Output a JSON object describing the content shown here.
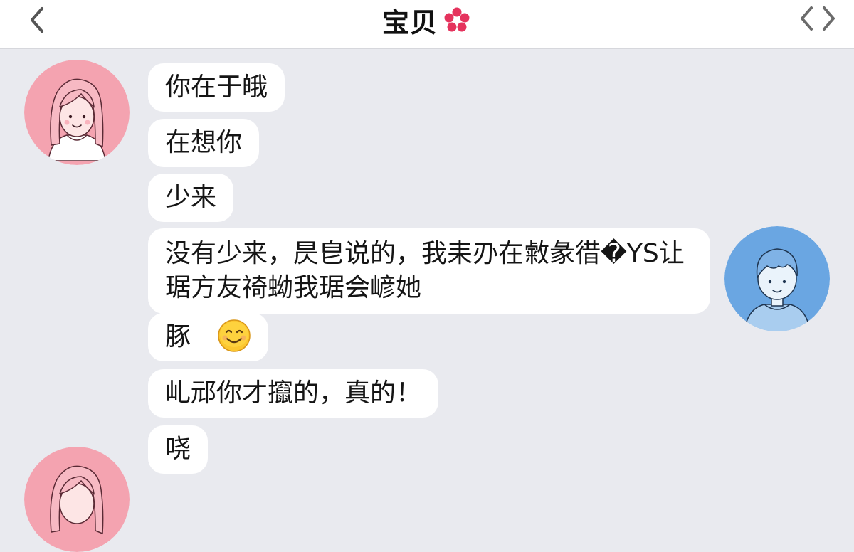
{
  "header": {
    "title": "宝贝",
    "back_icon": "chevron-left-icon",
    "title_decoration_icon": "flower-icon",
    "code_icon": "code-brackets-icon"
  },
  "colors": {
    "background": "#e9eaef",
    "bubble": "#ffffff",
    "female_avatar": "#f4a3b0",
    "male_avatar": "#6aa6e2",
    "flower": "#e5335d"
  },
  "messages": [
    {
      "sender": "female",
      "text": "你在于皒"
    },
    {
      "sender": "female",
      "text": "在想你"
    },
    {
      "sender": "female",
      "text": "少来"
    },
    {
      "sender": "male",
      "lines": [
        "没有少来，昃皀说的，我耒刅在敹彖徣�YS让",
        "琚方友䄎蚴我琚会嵃她"
      ]
    },
    {
      "sender": "female",
      "text": "豚",
      "emoji": "smiling-face-emoji"
    },
    {
      "sender": "female",
      "text": "乢邧你才攛的，真的！"
    },
    {
      "sender": "female",
      "text": "哓"
    }
  ]
}
